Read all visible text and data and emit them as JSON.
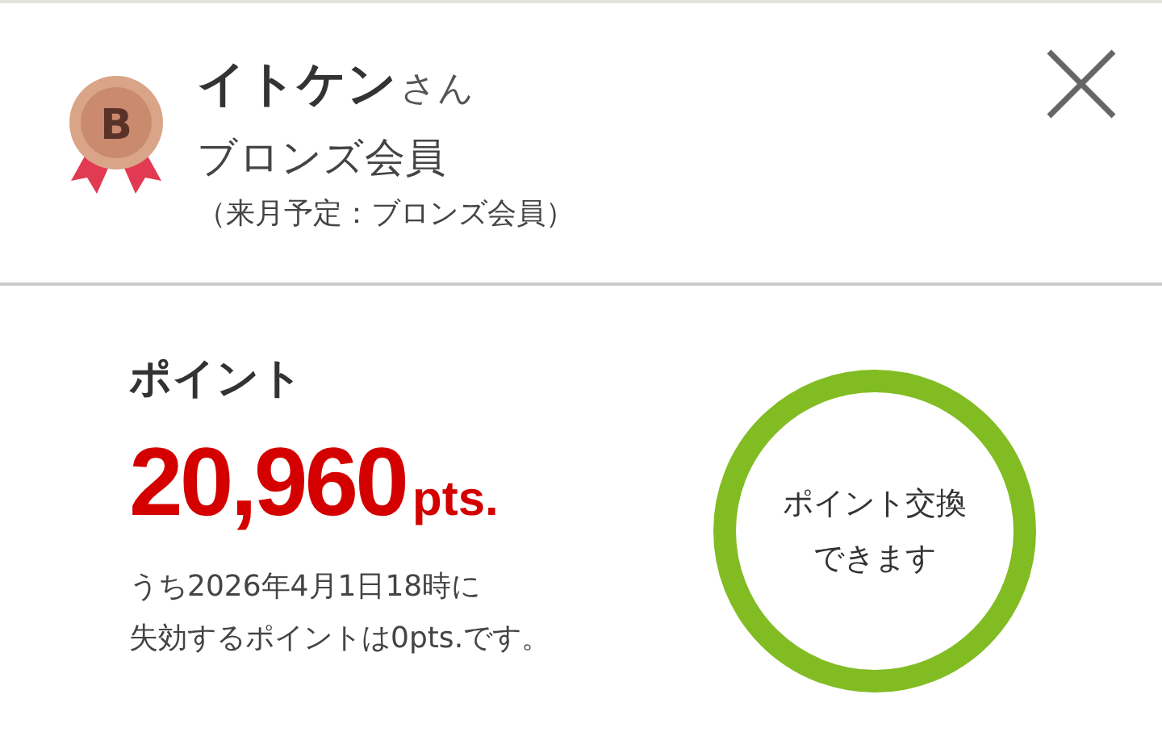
{
  "member": {
    "medal_letter": "B",
    "name": "イトケン",
    "honorific": "さん",
    "rank": "ブロンズ会員",
    "next_month": "（来月予定：ブロンズ会員）"
  },
  "points": {
    "title": "ポイント",
    "value": "20,960",
    "unit": "pts.",
    "note_lines": [
      "うち2026年4月1日18時に",
      "失効するポイントは0pts.です。"
    ]
  },
  "exchange": {
    "lines": [
      "ポイント交換",
      "できます"
    ]
  }
}
